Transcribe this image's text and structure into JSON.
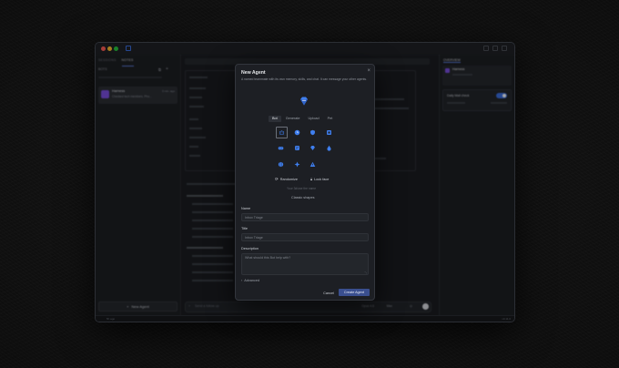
{
  "app": {
    "left_tabs": [
      "SESSIONS",
      "NOTES"
    ],
    "bots_label": "BOTS",
    "conversation": {
      "name": "Harness",
      "time": "3 min. ago",
      "preview": "Checked tech members. Pho..."
    },
    "new_agent_button": "New Agent",
    "status_left": "5h ago",
    "status_right": "v0.11.0",
    "right_tab": "OVERVIEW",
    "right_agent_name": "Harness",
    "daily_check_label": "Daily Mail check",
    "chat_placeholder": "Send a follow up",
    "model_label": "Opus 4.6",
    "mode_label": "Max"
  },
  "modal": {
    "title": "New Agent",
    "description": "A named teammate with its own memory, skills, and chat. It can message your other agents.",
    "tabs": [
      "Bot",
      "Generate",
      "Upload",
      "Pet"
    ],
    "selected_tab": "Bot",
    "randomize_label": "Randomize",
    "lock_face_label": "Lock face",
    "hint": "Your 3d/use the name",
    "shape_label": "Classic shapes",
    "name_label": "Name",
    "name_placeholder": "Inbox Triage",
    "title_label": "Title",
    "title_placeholder": "Inbox Triage",
    "description_label": "Description",
    "description_placeholder": "What should this Bot help with?",
    "advanced_label": "Advanced",
    "cancel_label": "Cancel",
    "create_label": "Create Agent",
    "icons": [
      "bot-icon",
      "clock-icon",
      "shield-icon",
      "grid-icon",
      "gamepad-icon",
      "chat-icon",
      "diamond-icon",
      "drop-icon",
      "globe-icon",
      "spark-icon",
      "triangle-icon"
    ],
    "selected_icon": "bot-icon"
  },
  "colors": {
    "accent": "#3b6fe0",
    "icon_blue": "#3f7ff0",
    "create_button": "#3a4f8f"
  }
}
